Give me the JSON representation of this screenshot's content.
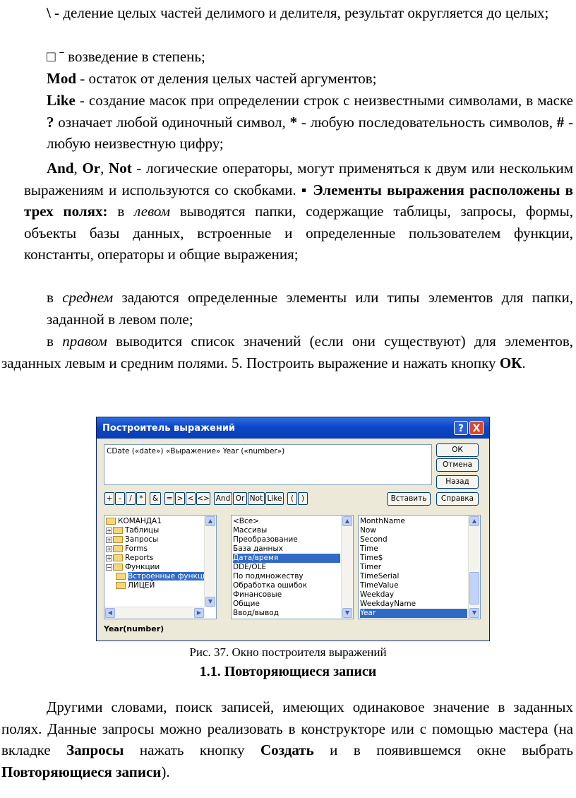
{
  "text": {
    "p1_sym": "\\",
    "p1_rest": " - деление целых частей делимого и делителя, результат округляется до целых;",
    "p2_glyph": "□",
    "p2_rest": " ˉ возведение в степень;",
    "p3_bold": "Mod",
    "p3_rest": " - остаток от деления целых частей аргументов;",
    "p4_bold": "Like",
    "p4_a": " - создание масок при определении строк с неизвестными символами, в маске ",
    "p4_q": "?",
    "p4_b": " означает любой одиночный символ, ",
    "p4_star": "*",
    "p4_c": " - любую последовательность символов, ",
    "p4_hash": "#",
    "p4_d": " - любую неизвестную цифру;",
    "p5_and": "And",
    "p5_sep1": ", ",
    "p5_or": "Or",
    "p5_sep2": ", ",
    "p5_not": "Not",
    "p5_a": " - логические операторы, могут применяться к двум или нескольким выражениям и используются со скобками. ",
    "p5_bullet": "▪",
    "p5_bold": " Элементы выражения расположены в трех полях:",
    "p5_b": " в ",
    "p5_left": "левом",
    "p5_c": " выводятся папки, содержащие таблицы, запросы, формы, объекты базы данных, встроенные и определенные пользователем функции, константы, операторы и общие выражения;",
    "p6_a": "в ",
    "p6_mid": "среднем",
    "p6_b": " задаются определенные элементы или типы элементов для папки, заданной в левом поле;",
    "p7_a": "в ",
    "p7_right": "правом",
    "p7_b": " выводится список значений (если они существуют) для элементов, заданных левым и средним полями. 5. Построить выражение и нажать кнопку ",
    "p7_ok": "ОК",
    "p7_end": ".",
    "caption": "Рис. 37. Окно построителя выражений",
    "heading": "1.1. Повторяющиеся записи",
    "p8_a": "Другими словами, поиск записей, имеющих одинаковое значение в заданных полях. Данные запросы можно реализовать в конструкторе или с помощью мастера (на вкладке ",
    "p8_q": "Запросы",
    "p8_b": " нажать кнопку ",
    "p8_c": "Создать",
    "p8_d": " и в появившемся окне выбрать ",
    "p8_e": "Повторяющиеся записи",
    "p8_f": ")."
  },
  "dialog": {
    "title": "Построитель выражений",
    "help": "?",
    "close": "X",
    "expression": "CDate («date») «Выражение» Year («number»)",
    "buttons": {
      "ok": "ОК",
      "cancel": "Отмена",
      "back": "Назад",
      "insert": "Вставить",
      "help": "Справка"
    },
    "operators": [
      "+",
      "-",
      "/",
      "*",
      "&",
      "=",
      ">",
      "<",
      "<>",
      "And",
      "Or",
      "Not",
      "Like",
      "(",
      ")"
    ],
    "left_list": [
      "КОМАНДА1",
      "Таблицы",
      "Запросы",
      "Forms",
      "Reports",
      "Функции",
      "Встроенные функции",
      "ЛИЦЕЙ"
    ],
    "middle_list": [
      "<Все>",
      "Массивы",
      "Преобразование",
      "База данных",
      "Дата/время",
      "DDE/OLE",
      "По подмножеству",
      "Обработка ошибок",
      "Финансовые",
      "Общие",
      "Ввод/вывод"
    ],
    "middle_selected": 4,
    "right_list": [
      "MonthName",
      "Now",
      "Second",
      "Time",
      "Time$",
      "Timer",
      "TimeSerial",
      "TimeValue",
      "Weekday",
      "WeekdayName",
      "Year"
    ],
    "right_selected": 10,
    "status": "Year(number)"
  },
  "colors": {
    "title_bar": "#0c46c8",
    "selection": "#316ac5",
    "dialog_bg": "#ece9d8"
  }
}
